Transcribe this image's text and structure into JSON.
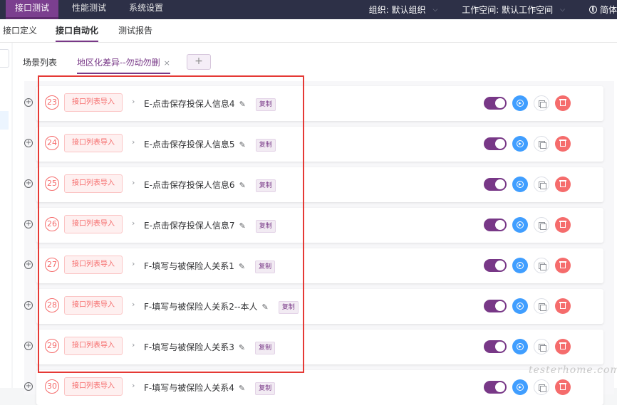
{
  "topnav": {
    "items": [
      {
        "label": "接口测试",
        "active": true
      },
      {
        "label": "性能测试",
        "active": false
      },
      {
        "label": "系统设置",
        "active": false
      }
    ],
    "org_selector": "组织: 默认组织",
    "workspace_selector": "工作空间: 默认工作空间",
    "language": "简体"
  },
  "subnav": {
    "items": [
      {
        "label": "接口定义",
        "active": false
      },
      {
        "label": "接口自动化",
        "active": true
      },
      {
        "label": "测试报告",
        "active": false
      }
    ]
  },
  "tabs": {
    "scenario_list": "场景列表",
    "active_tab": "地区化差异--勿动勿删",
    "close_glyph": "×",
    "add_glyph": "+"
  },
  "step_common": {
    "type_label": "接口列表导入",
    "copy_tag": "复制",
    "expand_glyph": "+",
    "arrow_glyph": "›",
    "edit_glyph": "✎"
  },
  "steps": [
    {
      "index": "23",
      "name": "E-点击保存投保人信息4",
      "enabled": true
    },
    {
      "index": "24",
      "name": "E-点击保存投保人信息5",
      "enabled": true
    },
    {
      "index": "25",
      "name": "E-点击保存投保人信息6",
      "enabled": true
    },
    {
      "index": "26",
      "name": "E-点击保存投保人信息7",
      "enabled": true
    },
    {
      "index": "27",
      "name": "F-填写与被保险人关系1",
      "enabled": true
    },
    {
      "index": "28",
      "name": "F-填写与被保险人关系2--本人",
      "enabled": true
    },
    {
      "index": "29",
      "name": "F-填写与被保险人关系3",
      "enabled": true
    },
    {
      "index": "30",
      "name": "F-填写与被保险人关系4",
      "enabled": true
    }
  ],
  "watermark": "testerhome.com",
  "colors": {
    "topbar": "#2d3047",
    "accent": "#783887",
    "run": "#409eff",
    "danger": "#f56c6c",
    "highlight": "#e53935"
  }
}
